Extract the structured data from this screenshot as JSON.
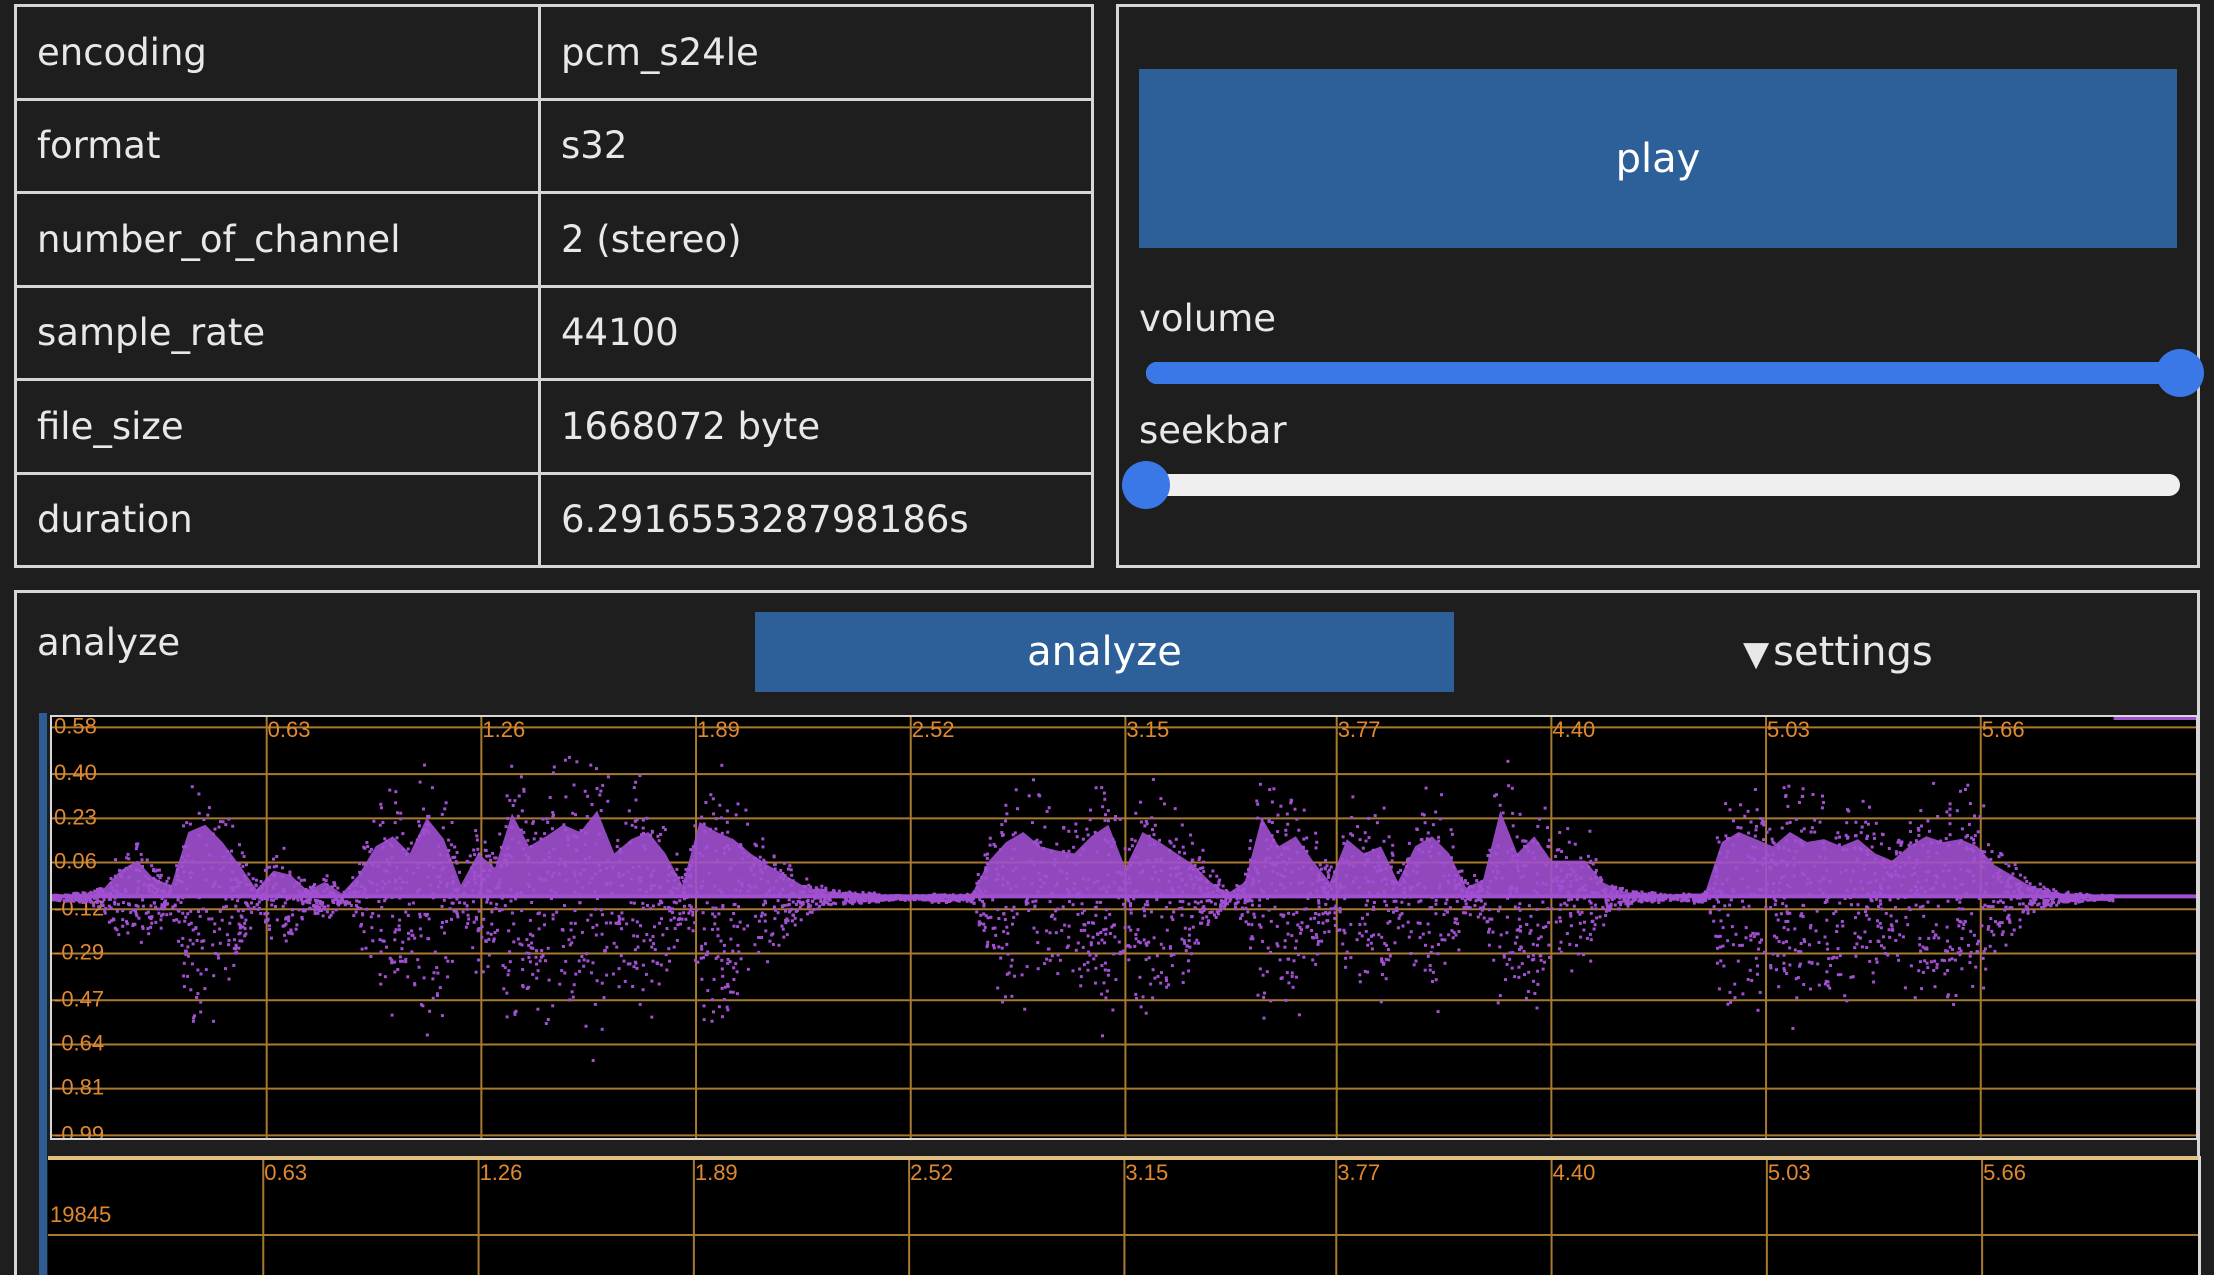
{
  "info": {
    "rows": [
      {
        "key": "encoding",
        "value": "pcm_s24le"
      },
      {
        "key": "format",
        "value": "s32"
      },
      {
        "key": "number_of_channel",
        "value": "2 (stereo)"
      },
      {
        "key": "sample_rate",
        "value": "44100"
      },
      {
        "key": "file_size",
        "value": "1668072 byte"
      },
      {
        "key": "duration",
        "value": "6.291655328798186s"
      }
    ]
  },
  "player": {
    "play_label": "play",
    "volume_label": "volume",
    "volume_value": 1.0,
    "seekbar_label": "seekbar",
    "seekbar_value": 0.0
  },
  "analyze": {
    "label": "analyze",
    "button_label": "analyze",
    "settings_icon": "triangle-down-icon",
    "settings_label": "settings"
  },
  "colors": {
    "waveform": "#a050d0",
    "grid": "#a87a30",
    "axis_text": "#e08830",
    "button": "#2d5f98",
    "slider_accent": "#3b78e7"
  },
  "chart_data": [
    {
      "type": "scatter",
      "name": "waveform",
      "x_ticks": [
        "0.63",
        "1.26",
        "1.89",
        "2.52",
        "3.15",
        "3.77",
        "4.40",
        "5.03",
        "5.66"
      ],
      "y_ticks": [
        "0.58",
        "0.40",
        "0.23",
        "0.06",
        "-0.12",
        "-0.29",
        "-0.47",
        "-0.64",
        "-0.81",
        "-0.99"
      ],
      "xlim": [
        0,
        6.2917
      ],
      "ylim": [
        -1.0,
        0.62
      ],
      "grid": true,
      "envelope": {
        "x": [
          0.0,
          0.1,
          0.15,
          0.2,
          0.25,
          0.3,
          0.35,
          0.4,
          0.45,
          0.5,
          0.55,
          0.6,
          0.65,
          0.7,
          0.75,
          0.8,
          0.85,
          0.9,
          0.95,
          1.0,
          1.05,
          1.1,
          1.15,
          1.2,
          1.25,
          1.3,
          1.35,
          1.4,
          1.45,
          1.5,
          1.55,
          1.6,
          1.65,
          1.7,
          1.75,
          1.8,
          1.85,
          1.9,
          1.95,
          2.0,
          2.05,
          2.1,
          2.15,
          2.2,
          2.25,
          2.3,
          2.35,
          2.4,
          2.45,
          2.5,
          2.55,
          2.6,
          2.65,
          2.7,
          2.75,
          2.8,
          2.85,
          2.9,
          2.95,
          3.0,
          3.05,
          3.1,
          3.15,
          3.2,
          3.25,
          3.3,
          3.35,
          3.4,
          3.45,
          3.5,
          3.55,
          3.6,
          3.65,
          3.7,
          3.75,
          3.8,
          3.85,
          3.9,
          3.95,
          4.0,
          4.05,
          4.1,
          4.15,
          4.2,
          4.25,
          4.3,
          4.35,
          4.4,
          4.45,
          4.5,
          4.55,
          4.6,
          4.65,
          4.7,
          4.75,
          4.8,
          4.85,
          4.9,
          4.95,
          5.0,
          5.05,
          5.1,
          5.15,
          5.2,
          5.25,
          5.3,
          5.35,
          5.4,
          5.45,
          5.5,
          5.55,
          5.6,
          5.65,
          5.7,
          5.75,
          5.8,
          5.85,
          5.9,
          5.95,
          6.0,
          6.05,
          6.1,
          6.15,
          6.2,
          6.29
        ],
        "amp": [
          0.01,
          0.02,
          0.05,
          0.18,
          0.25,
          0.12,
          0.08,
          0.45,
          0.5,
          0.38,
          0.22,
          0.05,
          0.18,
          0.15,
          0.04,
          0.1,
          0.02,
          0.15,
          0.35,
          0.42,
          0.3,
          0.55,
          0.4,
          0.08,
          0.3,
          0.2,
          0.58,
          0.35,
          0.42,
          0.5,
          0.45,
          0.6,
          0.3,
          0.4,
          0.45,
          0.3,
          0.08,
          0.52,
          0.45,
          0.4,
          0.3,
          0.22,
          0.15,
          0.08,
          0.04,
          0.03,
          0.02,
          0.02,
          0.01,
          0.01,
          0.01,
          0.02,
          0.01,
          0.02,
          0.25,
          0.38,
          0.45,
          0.35,
          0.32,
          0.3,
          0.42,
          0.5,
          0.2,
          0.45,
          0.38,
          0.3,
          0.22,
          0.1,
          0.02,
          0.1,
          0.55,
          0.35,
          0.42,
          0.25,
          0.1,
          0.4,
          0.3,
          0.35,
          0.1,
          0.35,
          0.42,
          0.3,
          0.06,
          0.12,
          0.6,
          0.3,
          0.42,
          0.25,
          0.25,
          0.25,
          0.1,
          0.04,
          0.02,
          0.02,
          0.01,
          0.02,
          0.02,
          0.38,
          0.45,
          0.4,
          0.35,
          0.45,
          0.38,
          0.4,
          0.35,
          0.4,
          0.3,
          0.25,
          0.35,
          0.42,
          0.38,
          0.4,
          0.35,
          0.22,
          0.15,
          0.08,
          0.04,
          0.02,
          0.02,
          0.01,
          0.01
        ]
      }
    },
    {
      "type": "heatmap",
      "name": "spectrogram",
      "x_ticks": [
        "0.63",
        "1.26",
        "1.89",
        "2.52",
        "3.15",
        "3.77",
        "4.40",
        "5.03",
        "5.66"
      ],
      "y_ticks": [
        "19845"
      ],
      "xlim": [
        0,
        6.2917
      ],
      "grid": true
    }
  ]
}
